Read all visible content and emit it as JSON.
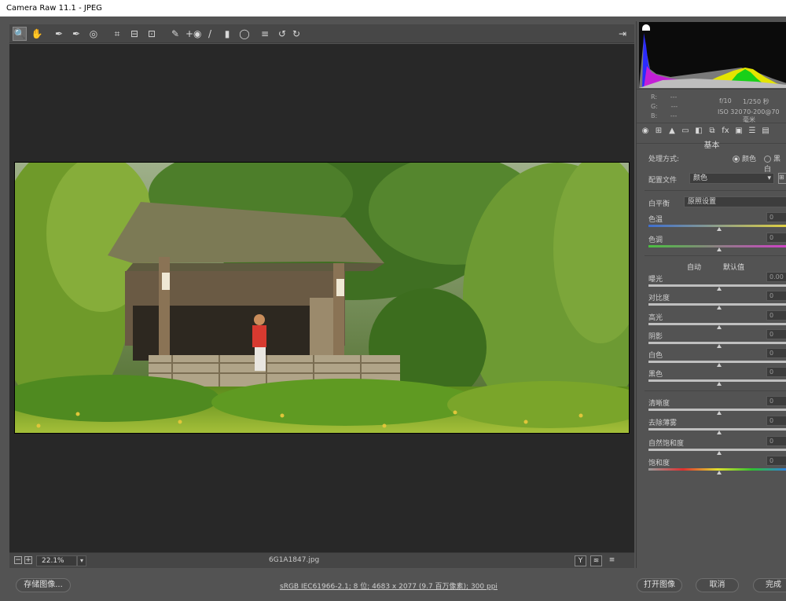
{
  "window": {
    "title": "Camera Raw 11.1 - JPEG"
  },
  "toolbar": {
    "tools": [
      {
        "name": "zoom-tool-icon",
        "glyph": "🔍"
      },
      {
        "name": "hand-tool-icon",
        "glyph": "✋"
      },
      {
        "name": "white-balance-tool-icon",
        "glyph": "✒"
      },
      {
        "name": "color-sampler-tool-icon",
        "glyph": "✒"
      },
      {
        "name": "targeted-adjustment-tool-icon",
        "glyph": "◎"
      },
      {
        "name": "crop-tool-icon",
        "glyph": "⌗"
      },
      {
        "name": "straighten-tool-icon",
        "glyph": "⊟"
      },
      {
        "name": "transform-tool-icon",
        "glyph": "⊡"
      },
      {
        "name": "spot-removal-tool-icon",
        "glyph": "✎"
      },
      {
        "name": "red-eye-removal-tool-icon",
        "glyph": "+◉"
      },
      {
        "name": "adjustment-brush-icon",
        "glyph": "/"
      },
      {
        "name": "graduated-filter-icon",
        "glyph": "▮"
      },
      {
        "name": "radial-filter-icon",
        "glyph": "◯"
      },
      {
        "name": "preferences-icon",
        "glyph": "≡"
      },
      {
        "name": "rotate-left-icon",
        "glyph": "↺"
      },
      {
        "name": "rotate-right-icon",
        "glyph": "↻"
      }
    ],
    "export_glyph": "⇥"
  },
  "status": {
    "zoom_value": "22.1%",
    "zoom_dropdown": "▾",
    "zoom_out": "−",
    "zoom_in": "+",
    "filename": "6G1A1847.jpg",
    "btn_y": "Y",
    "btn_compare": "≋",
    "btn_settings": "≡"
  },
  "bottom": {
    "save_label": "存储图像...",
    "workflow_text": "sRGB IEC61966-2.1; 8 位; 4683 x 2077 (9.7 百万像素); 300 ppi",
    "open_label": "打开图像",
    "cancel_label": "取消",
    "done_label": "完成"
  },
  "info": {
    "r_label": "R:",
    "g_label": "G:",
    "b_label": "B:",
    "r_value": "---",
    "g_value": "---",
    "b_value": "---",
    "aperture": "f/10",
    "shutter": "1/250 秒",
    "iso": "ISO 320",
    "lens": "70-200@70 毫米"
  },
  "panel": {
    "title": "基本",
    "tabs": [
      "◉",
      "⊞",
      "▲",
      "▭",
      "◧",
      "⧉",
      "fx",
      "▣",
      "☰",
      "▤"
    ],
    "treatment_label": "处理方式:",
    "treatment_color": "颜色",
    "treatment_bw": "黑白",
    "profile_label": "配置文件",
    "profile_value": "颜色",
    "wb_label": "白平衡",
    "wb_value": "原照设置",
    "temp_label": "色温",
    "tint_label": "色调",
    "auto_label": "自动",
    "default_label": "默认值",
    "exposure_label": "曝光",
    "exposure_value": "0.00",
    "contrast_label": "对比度",
    "highlights_label": "高光",
    "shadows_label": "阴影",
    "whites_label": "白色",
    "blacks_label": "黑色",
    "texture_label": "清晰度",
    "dehaze_label": "去除薄雾",
    "vibrance_label": "自然饱和度",
    "saturation_label": "饱和度",
    "zero": "0"
  },
  "colors": {
    "accent": "#535353",
    "preview_bg": "#282828"
  }
}
